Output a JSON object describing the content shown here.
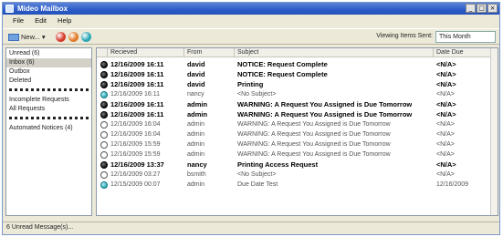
{
  "window": {
    "title": "Mideo Mailbox",
    "buttons": [
      "_",
      "□",
      "×"
    ]
  },
  "menu": [
    "File",
    "Edit",
    "Help"
  ],
  "toolbar": {
    "new_label": "New...",
    "new_dropdown": "▾",
    "viewing_label": "Viewing Items Sent:",
    "viewing_value": "This Month",
    "icons": [
      "delete-icon",
      "tag-icon",
      "refresh-icon"
    ],
    "icon_colors": [
      "#d53a2a",
      "#e07a2a",
      "#2aa6b5"
    ]
  },
  "sidebar": {
    "items": [
      {
        "label": "Unread (6)"
      },
      {
        "label": "Inbox (6)"
      },
      {
        "label": "Outbox"
      },
      {
        "label": "Deleted"
      },
      {
        "label": "Incomplete Requests"
      },
      {
        "label": "All Requests"
      },
      {
        "label": "Automated Notices (4)"
      }
    ]
  },
  "columns": [
    "Recieved",
    "From",
    "Subject",
    "Date Due"
  ],
  "messages": [
    {
      "received": "12/16/2009 16:11",
      "from": "david",
      "subject": "NOTICE: Request Complete",
      "due": "<N/A>",
      "unread": true,
      "icon": "dark"
    },
    {
      "received": "12/16/2009 16:11",
      "from": "david",
      "subject": "NOTICE: Request Complete",
      "due": "<N/A>",
      "unread": true,
      "icon": "dark"
    },
    {
      "received": "12/16/2009 16:11",
      "from": "david",
      "subject": "Printing",
      "due": "<N/A>",
      "unread": true,
      "icon": "dark"
    },
    {
      "received": "12/16/2009 16:11",
      "from": "nancy",
      "subject": "<No Subject>",
      "due": "<N/A>",
      "unread": false,
      "icon": "teal"
    },
    {
      "received": "12/16/2009 16:11",
      "from": "admin",
      "subject": "WARNING: A Request You Assigned is Due Tomorrow",
      "due": "<N/A>",
      "unread": true,
      "icon": "dark"
    },
    {
      "received": "12/16/2009 16:11",
      "from": "admin",
      "subject": "WARNING: A Request You Assigned is Due Tomorrow",
      "due": "<N/A>",
      "unread": true,
      "icon": "dark"
    },
    {
      "received": "12/16/2009 16:04",
      "from": "admin",
      "subject": "WARNING: A Request You Assigned is Due Tomorrow",
      "due": "<N/A>",
      "unread": false,
      "icon": "empty"
    },
    {
      "received": "12/16/2009 16:04",
      "from": "admin",
      "subject": "WARNING: A Request You Assigned is Due Tomorrow",
      "due": "<N/A>",
      "unread": false,
      "icon": "empty"
    },
    {
      "received": "12/16/2009 15:59",
      "from": "admin",
      "subject": "WARNING: A Request You Assigned is Due Tomorrow",
      "due": "<N/A>",
      "unread": false,
      "icon": "empty"
    },
    {
      "received": "12/16/2009 15:59",
      "from": "admin",
      "subject": "WARNING: A Request You Assigned is Due Tomorrow",
      "due": "<N/A>",
      "unread": false,
      "icon": "empty"
    },
    {
      "received": "12/16/2009 13:37",
      "from": "nancy",
      "subject": "Printing Access Request",
      "due": "<N/A>",
      "unread": true,
      "icon": "dark"
    },
    {
      "received": "12/16/2009 03:27",
      "from": "bsmith",
      "subject": "<No Subject>",
      "due": "<N/A>",
      "unread": false,
      "icon": "empty"
    },
    {
      "received": "12/15/2009 00:07",
      "from": "admin",
      "subject": "Due Date Test",
      "due": "12/16/2009",
      "unread": false,
      "icon": "teal"
    }
  ],
  "status": {
    "text": "6 Unread Message(s)..."
  }
}
